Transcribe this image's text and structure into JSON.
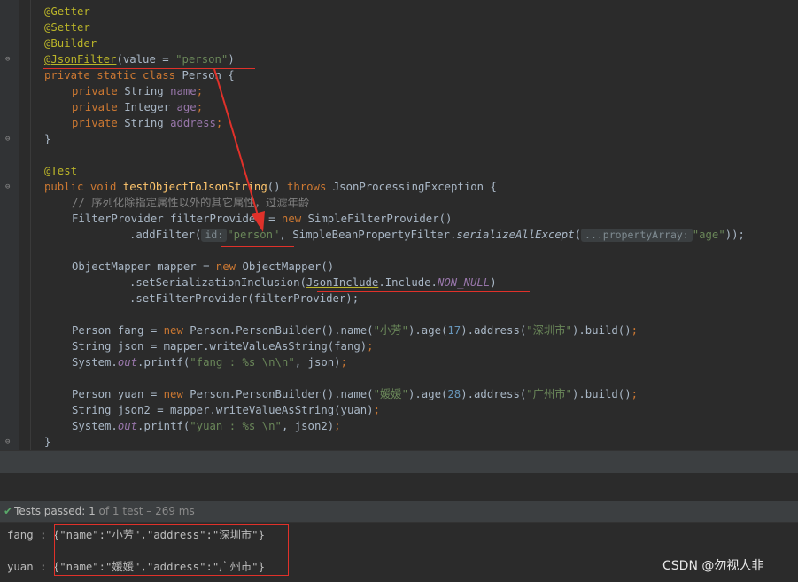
{
  "editor": {
    "lines": {
      "l1": "@Getter",
      "l2": "@Setter",
      "l3": "@Builder",
      "l4_ann": "@JsonFilter",
      "l4_a": "(value = ",
      "l4_str": "\"person\"",
      "l4_b": ")",
      "l5_kw": "private static class ",
      "l5_rest": "Person {",
      "l6_kw": "private ",
      "l6_type": "String ",
      "l6_fld": "name",
      "l6_semi": ";",
      "l7_kw": "private ",
      "l7_type": "Integer ",
      "l7_fld": "age",
      "l7_semi": ";",
      "l8_kw": "private ",
      "l8_type": "String ",
      "l8_fld": "address",
      "l8_semi": ";",
      "l9": "}",
      "l11": "@Test",
      "l12_kw": "public void ",
      "l12_fn": "testObjectToJsonString",
      "l12_a": "() ",
      "l12_kw2": "throws ",
      "l12_b": "JsonProcessingException {",
      "l13": "// 序列化除指定属性以外的其它属性，过滤年龄",
      "l14_a": "FilterProvider filterProvider = ",
      "l14_kw": "new ",
      "l14_b": "SimpleFilterProvider()",
      "l15_a": ".addFilter(",
      "l15_hint": "id:",
      "l15_str": "\"person\"",
      "l15_b": ", SimpleBeanPropertyFilter.",
      "l15_it": "serializeAllExcept",
      "l15_c": "(",
      "l15_hint2": "...propertyArray:",
      "l15_str2": "\"age\"",
      "l15_d": "));",
      "l17_a": "ObjectMapper mapper = ",
      "l17_kw": "new ",
      "l17_b": "ObjectMapper()",
      "l18_a": ".setSerializationInclusion(",
      "l18_cls": "JsonInclude",
      "l18_b": ".Include.",
      "l18_c": "NON_NULL",
      "l18_d": ")",
      "l19": ".setFilterProvider(filterProvider);",
      "l21_a": "Person fang = ",
      "l21_kw": "new ",
      "l21_b": "Person.PersonBuilder().name(",
      "l21_s1": "\"小芳\"",
      "l21_c": ").age(",
      "l21_n": "17",
      "l21_d": ").address(",
      "l21_s2": "\"深圳市\"",
      "l21_e": ").build()",
      "l21_f": ";",
      "l22_a": "String json = mapper.writeValueAsString(fang)",
      "l22_b": ";",
      "l23_a": "System.",
      "l23_out": "out",
      "l23_b": ".printf(",
      "l23_str": "\"fang : %s \\n\\n\"",
      "l23_c": ", json)",
      "l23_d": ";",
      "l25_a": "Person yuan = ",
      "l25_kw": "new ",
      "l25_b": "Person.PersonBuilder().name(",
      "l25_s1": "\"媛媛\"",
      "l25_c": ").age(",
      "l25_n": "28",
      "l25_d": ").address(",
      "l25_s2": "\"广州市\"",
      "l25_e": ").build()",
      "l25_f": ";",
      "l26_a": "String json2 = mapper.writeValueAsString(yuan)",
      "l26_b": ";",
      "l27_a": "System.",
      "l27_out": "out",
      "l27_b": ".printf(",
      "l27_str": "\"yuan : %s \\n\"",
      "l27_c": ", json2)",
      "l27_d": ";",
      "l28": "}"
    }
  },
  "run_panel": {
    "status_icon": "check-icon",
    "status_label": "Tests passed: ",
    "status_count": "1",
    "status_of": " of 1 test",
    "status_time": " – 269 ms",
    "out1_label": "fang : ",
    "out1_json": "{\"name\":\"小芳\",\"address\":\"深圳市\"}",
    "out2_label": "yuan : ",
    "out2_json": "{\"name\":\"媛媛\",\"address\":\"广州市\"}"
  },
  "watermark": "CSDN @勿视人非",
  "colors": {
    "background": "#2b2b2b",
    "keyword": "#cc7832",
    "string": "#6a8759",
    "annotation": "#bbb529",
    "field": "#9876aa",
    "method": "#ffc66d",
    "number": "#6897bb",
    "highlight": "#e0312a",
    "pass": "#59a869"
  }
}
